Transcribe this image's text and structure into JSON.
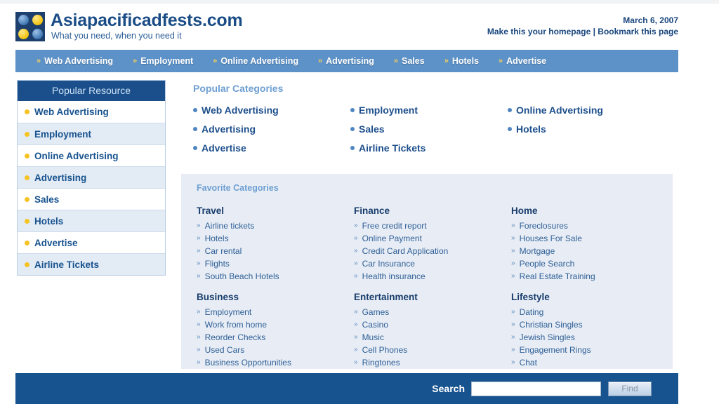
{
  "site": {
    "title": "Asiapacificadfests.com",
    "tagline": "What you need, when you need it",
    "logo_icon": "four-squares-logo-icon"
  },
  "header": {
    "date": "March 6, 2007",
    "homepage_link": "Make this your homepage",
    "separator": "|",
    "bookmark_link": "Bookmark this page"
  },
  "nav": {
    "arrow_icon": "chevron-right-icon",
    "items": [
      {
        "label": "Web Advertising"
      },
      {
        "label": "Employment"
      },
      {
        "label": "Online Advertising"
      },
      {
        "label": "Advertising"
      },
      {
        "label": "Sales"
      },
      {
        "label": "Hotels"
      },
      {
        "label": "Advertise"
      }
    ]
  },
  "sidebar": {
    "heading": "Popular Resource",
    "bullet_icon": "yellow-dot-icon",
    "items": [
      {
        "label": "Web Advertising"
      },
      {
        "label": "Employment"
      },
      {
        "label": "Online Advertising"
      },
      {
        "label": "Advertising"
      },
      {
        "label": "Sales"
      },
      {
        "label": "Hotels"
      },
      {
        "label": "Advertise"
      },
      {
        "label": "Airline Tickets"
      }
    ]
  },
  "popular_categories": {
    "title": "Popular Categories",
    "bullet_icon": "blue-dot-icon",
    "items": [
      {
        "label": "Web Advertising"
      },
      {
        "label": "Employment"
      },
      {
        "label": "Online Advertising"
      },
      {
        "label": "Advertising"
      },
      {
        "label": "Sales"
      },
      {
        "label": "Hotels"
      },
      {
        "label": "Advertise"
      },
      {
        "label": "Airline Tickets"
      },
      {
        "label": ""
      }
    ]
  },
  "favorite_categories": {
    "title": "Favorite Categories",
    "chevron_icon": "double-chevron-right-icon",
    "columns": [
      {
        "title": "Travel",
        "links": [
          "Airline tickets",
          "Hotels",
          "Car rental",
          "Flights",
          "South Beach Hotels"
        ]
      },
      {
        "title": "Finance",
        "links": [
          "Free credit report",
          "Online Payment",
          "Credit Card Application",
          "Car Insurance",
          "Health insurance"
        ]
      },
      {
        "title": "Home",
        "links": [
          "Foreclosures",
          "Houses For Sale",
          "Mortgage",
          "People Search",
          "Real Estate Training"
        ]
      },
      {
        "title": "Business",
        "links": [
          "Employment",
          "Work from home",
          "Reorder Checks",
          "Used Cars",
          "Business Opportunities"
        ]
      },
      {
        "title": "Entertainment",
        "links": [
          "Games",
          "Casino",
          "Music",
          "Cell Phones",
          "Ringtones"
        ]
      },
      {
        "title": "Lifestyle",
        "links": [
          "Dating",
          "Christian Singles",
          "Jewish Singles",
          "Engagement Rings",
          "Chat"
        ]
      }
    ]
  },
  "footer": {
    "search_label": "Search",
    "search_value": "",
    "search_placeholder": "",
    "find_label": "Find"
  },
  "colors": {
    "nav_blue": "#5d92c8",
    "deep_blue": "#17538f",
    "sidebar_head": "#1a4f8b",
    "panel_bg": "#e8edf5",
    "accent_yellow": "#f5c322",
    "link_blue": "#2e5f96"
  }
}
